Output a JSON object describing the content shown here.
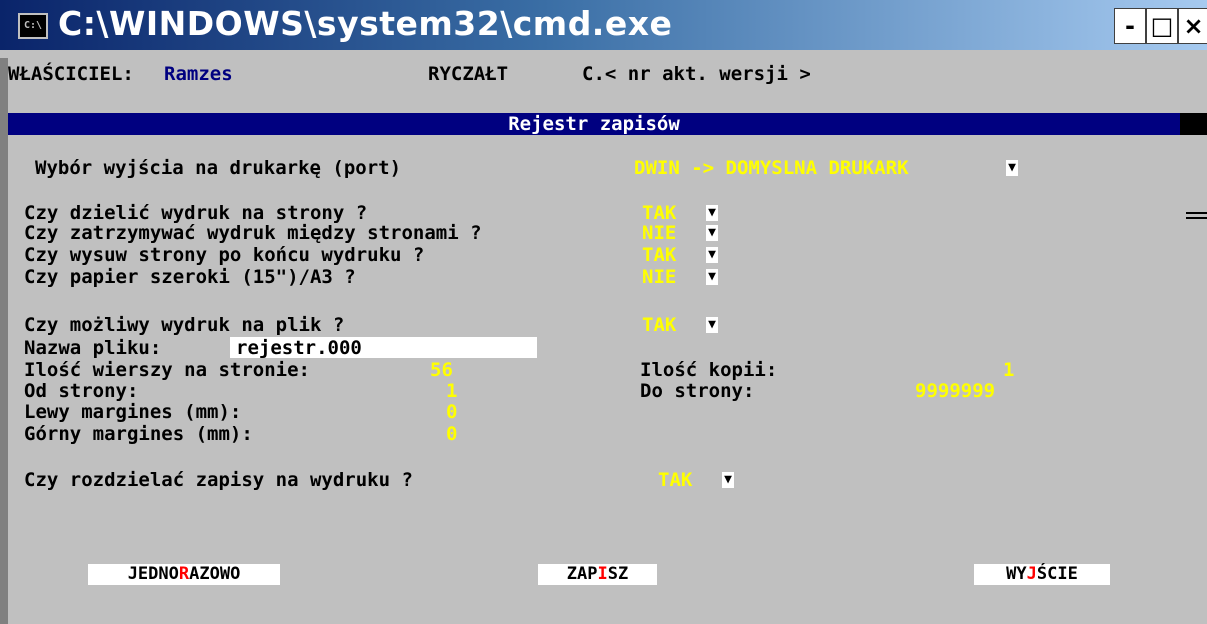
{
  "window": {
    "title": "C:\\WINDOWS\\system32\\cmd.exe",
    "icon_label": "C:\\",
    "min_glyph": "-",
    "max_glyph": "□",
    "close_glyph": "×"
  },
  "header": {
    "owner_label": "WŁAŚCICIEL:",
    "owner_value": "Ramzes",
    "tax_type": "RYCZAŁT",
    "version": "C.< nr akt. wersji >"
  },
  "banner": {
    "title": "Rejestr zapisów"
  },
  "form": {
    "printer_port": {
      "label": "Wybór wyjścia na drukarkę (port)",
      "value": "DWIN -> DOMYSLNA DRUKARK"
    },
    "split_pages": {
      "label": "Czy dzielić wydruk na strony ?",
      "value": "TAK"
    },
    "pause_between": {
      "label": "Czy zatrzymywać wydruk między stronami ?",
      "value": "NIE"
    },
    "eject_page": {
      "label": "Czy wysuw strony po końcu wydruku ?",
      "value": "TAK"
    },
    "wide_paper": {
      "label": "Czy papier szeroki (15\")/A3 ?",
      "value": "NIE"
    },
    "print_to_file": {
      "label": "Czy możliwy wydruk na plik ?",
      "value": "TAK"
    },
    "file_name": {
      "label": "Nazwa pliku:",
      "value": "rejestr.000"
    },
    "rows_per_page": {
      "label": "Ilość wierszy na stronie:",
      "value": "56"
    },
    "copies": {
      "label": "Ilość kopii:",
      "value": "1"
    },
    "from_page": {
      "label": "Od strony:",
      "value": "1"
    },
    "to_page": {
      "label": "Do strony:",
      "value": "9999999"
    },
    "left_margin": {
      "label": "Lewy margines (mm):",
      "value": "0"
    },
    "top_margin": {
      "label": "Górny margines (mm):",
      "value": "0"
    },
    "separate_records": {
      "label": "Czy rozdzielać zapisy na wydruku ?",
      "value": "TAK"
    },
    "dropdown_glyph": "▼"
  },
  "buttons": {
    "once": {
      "pre": "JEDNO",
      "hot": "R",
      "post": "AZOWO"
    },
    "save": {
      "pre": "ZAP",
      "hot": "I",
      "post": "SZ"
    },
    "exit": {
      "pre": "WY",
      "hot": "J",
      "post": "ŚCIE"
    }
  },
  "colors": {
    "title_bar": "#0a246a",
    "console_bg": "#c0c0c0",
    "banner_bg": "#000080",
    "value_text": "#ffff00",
    "hotkey": "#ff0000"
  }
}
